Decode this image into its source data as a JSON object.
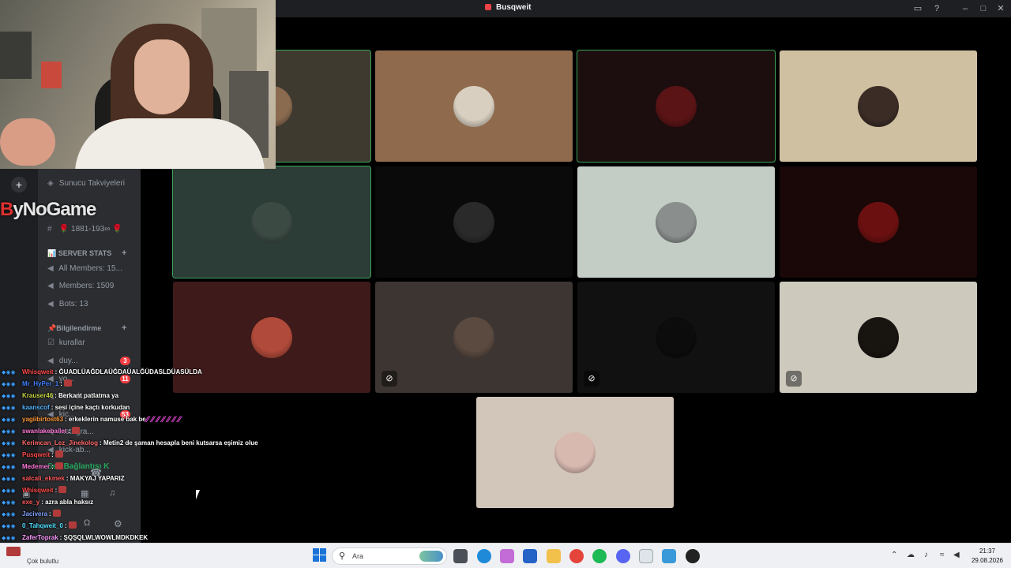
{
  "window": {
    "title": "Busqweit"
  },
  "logo": {
    "text_a": "B",
    "text_b": "yNoGame"
  },
  "sidebar": {
    "channels": [
      {
        "icon": "boost-icon",
        "label": "Sunucu Takviyeleri"
      },
      {
        "icon": "hash-icon",
        "label": "🌹 1881-193∞ 🌹"
      }
    ],
    "server_stats": {
      "category": "📊 SERVER STATS",
      "items": [
        "All Members: 15...",
        "Members: 1509",
        "Bots: 13"
      ]
    },
    "bilgilendirme": {
      "category": "📌Bilgilendirme",
      "items": [
        {
          "label": "kurallar",
          "badge": ""
        },
        {
          "label": "duy...",
          "badge": "3"
        },
        {
          "label": "yo...",
          "badge": "11"
        },
        {
          "label": "kick-d...",
          "badge": ""
        },
        {
          "label": "kic...",
          "badge": "53"
        },
        {
          "label": "instagra...",
          "badge": ""
        },
        {
          "label": "kick-ab...",
          "badge": ""
        }
      ]
    },
    "voice_status": "Ses Bağlantısı K"
  },
  "grid": {
    "tiles": [
      {
        "bg": "#3f3a30",
        "speaking": true,
        "avatar": "#8a6b4f",
        "muted": false
      },
      {
        "bg": "#8f6a4d",
        "speaking": false,
        "avatar": "#d8cfc0",
        "muted": false
      },
      {
        "bg": "#1c0d0f",
        "speaking": true,
        "avatar": "#5a1416",
        "muted": false
      },
      {
        "bg": "#cfc0a1",
        "speaking": false,
        "avatar": "#3b2c26",
        "muted": false
      },
      {
        "bg": "#2c3c36",
        "speaking": true,
        "avatar": "#3c4a44",
        "muted": false
      },
      {
        "bg": "#0a0a0a",
        "speaking": false,
        "avatar": "#2a2a2a",
        "muted": false
      },
      {
        "bg": "#c3ccc5",
        "speaking": false,
        "avatar": "#8a8f8d",
        "muted": false
      },
      {
        "bg": "#1a0707",
        "speaking": false,
        "avatar": "#6a1010",
        "muted": false
      },
      {
        "bg": "#3e1a1a",
        "speaking": false,
        "avatar": "#b04a3a",
        "muted": false
      },
      {
        "bg": "#3d3532",
        "speaking": false,
        "avatar": "#5a4a40",
        "muted": true
      },
      {
        "bg": "#111111",
        "speaking": false,
        "avatar": "#0c0c0c",
        "muted": true
      },
      {
        "bg": "#cdc9bd",
        "speaking": false,
        "avatar": "#181410",
        "muted": true
      },
      {
        "bg": "#d2c5b9",
        "speaking": false,
        "avatar": "#d8b9b0",
        "muted": false
      }
    ]
  },
  "chat": [
    {
      "user": "Whisqweit",
      "color": "#ff4a4a",
      "msg": "ĞUADLÜAĞDLAÜĞDAÜALĞÜDASLDÜASÜLDA"
    },
    {
      "user": "Mr_HyPer_1",
      "color": "#3f7fff",
      "msg": ""
    },
    {
      "user": "Krauser46",
      "color": "#c6d640",
      "msg": "Berkant patlatma ya"
    },
    {
      "user": "kaanscof",
      "color": "#4fb3ff",
      "msg": "sesi içine kaçtı korkudan"
    },
    {
      "user": "yagiibirtost63",
      "color": "#ff9a3a",
      "msg": "erkeklerin namuse bak be"
    },
    {
      "user": "swanlakeballet",
      "color": "#ff7ad9",
      "msg": ""
    },
    {
      "user": "Kerimcan_Lez_Jinekolog",
      "color": "#ff6a6a",
      "msg": "Metin2 de şaman hesapla beni kutsarsa eşimiz olue"
    },
    {
      "user": "Pusqweit",
      "color": "#ff4a4a",
      "msg": ""
    },
    {
      "user": "Medemer",
      "color": "#ff7ad9",
      "msg": ""
    },
    {
      "user": "salcali_ekmek",
      "color": "#ff5a5a",
      "msg": "MAKYAJ YAPARIZ"
    },
    {
      "user": "Whisqweit",
      "color": "#ff4a4a",
      "msg": ""
    },
    {
      "user": "exe_y",
      "color": "#ff5a5a",
      "msg": "azra abla haksız"
    },
    {
      "user": "Jacivera",
      "color": "#7fa0ff",
      "msg": ""
    },
    {
      "user": "0_Tahqweit_0",
      "color": "#4fe0ff",
      "msg": ""
    },
    {
      "user": "ZaferToprak",
      "color": "#ff9aff",
      "msg": "ŞQŞQLWLWOWLMDKDKEK"
    },
    {
      "user": "Pusqweit",
      "color": "#ff4a4a",
      "msg": ""
    }
  ],
  "taskbar": {
    "weather": "Çok bulutlu",
    "search_placeholder": "Ara",
    "time": "21:37",
    "date": "29.08.2026"
  }
}
